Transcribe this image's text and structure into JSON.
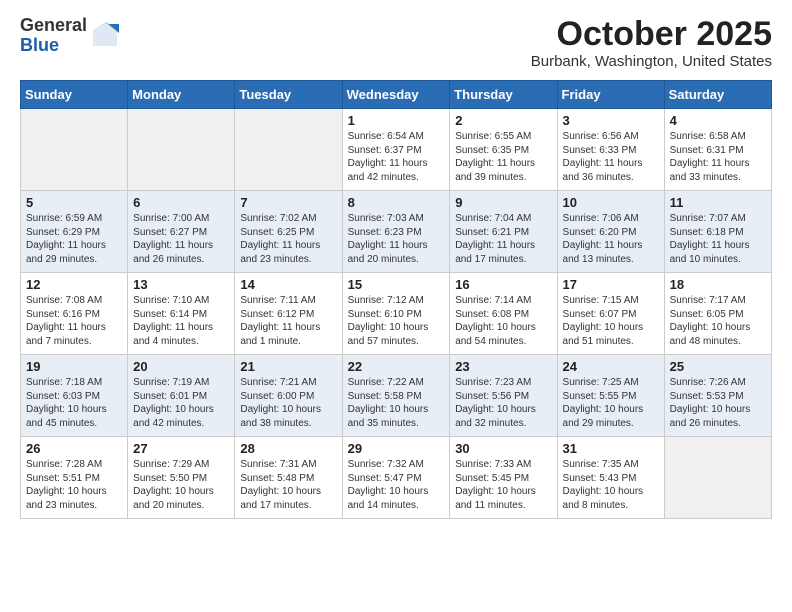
{
  "logo": {
    "general": "General",
    "blue": "Blue"
  },
  "header": {
    "month": "October 2025",
    "location": "Burbank, Washington, United States"
  },
  "weekdays": [
    "Sunday",
    "Monday",
    "Tuesday",
    "Wednesday",
    "Thursday",
    "Friday",
    "Saturday"
  ],
  "weeks": [
    [
      {
        "day": "",
        "empty": true
      },
      {
        "day": "",
        "empty": true
      },
      {
        "day": "",
        "empty": true
      },
      {
        "day": "1",
        "sunrise": "6:54 AM",
        "sunset": "6:37 PM",
        "daylight": "11 hours and 42 minutes."
      },
      {
        "day": "2",
        "sunrise": "6:55 AM",
        "sunset": "6:35 PM",
        "daylight": "11 hours and 39 minutes."
      },
      {
        "day": "3",
        "sunrise": "6:56 AM",
        "sunset": "6:33 PM",
        "daylight": "11 hours and 36 minutes."
      },
      {
        "day": "4",
        "sunrise": "6:58 AM",
        "sunset": "6:31 PM",
        "daylight": "11 hours and 33 minutes."
      }
    ],
    [
      {
        "day": "5",
        "sunrise": "6:59 AM",
        "sunset": "6:29 PM",
        "daylight": "11 hours and 29 minutes."
      },
      {
        "day": "6",
        "sunrise": "7:00 AM",
        "sunset": "6:27 PM",
        "daylight": "11 hours and 26 minutes."
      },
      {
        "day": "7",
        "sunrise": "7:02 AM",
        "sunset": "6:25 PM",
        "daylight": "11 hours and 23 minutes."
      },
      {
        "day": "8",
        "sunrise": "7:03 AM",
        "sunset": "6:23 PM",
        "daylight": "11 hours and 20 minutes."
      },
      {
        "day": "9",
        "sunrise": "7:04 AM",
        "sunset": "6:21 PM",
        "daylight": "11 hours and 17 minutes."
      },
      {
        "day": "10",
        "sunrise": "7:06 AM",
        "sunset": "6:20 PM",
        "daylight": "11 hours and 13 minutes."
      },
      {
        "day": "11",
        "sunrise": "7:07 AM",
        "sunset": "6:18 PM",
        "daylight": "11 hours and 10 minutes."
      }
    ],
    [
      {
        "day": "12",
        "sunrise": "7:08 AM",
        "sunset": "6:16 PM",
        "daylight": "11 hours and 7 minutes."
      },
      {
        "day": "13",
        "sunrise": "7:10 AM",
        "sunset": "6:14 PM",
        "daylight": "11 hours and 4 minutes."
      },
      {
        "day": "14",
        "sunrise": "7:11 AM",
        "sunset": "6:12 PM",
        "daylight": "11 hours and 1 minute."
      },
      {
        "day": "15",
        "sunrise": "7:12 AM",
        "sunset": "6:10 PM",
        "daylight": "10 hours and 57 minutes."
      },
      {
        "day": "16",
        "sunrise": "7:14 AM",
        "sunset": "6:08 PM",
        "daylight": "10 hours and 54 minutes."
      },
      {
        "day": "17",
        "sunrise": "7:15 AM",
        "sunset": "6:07 PM",
        "daylight": "10 hours and 51 minutes."
      },
      {
        "day": "18",
        "sunrise": "7:17 AM",
        "sunset": "6:05 PM",
        "daylight": "10 hours and 48 minutes."
      }
    ],
    [
      {
        "day": "19",
        "sunrise": "7:18 AM",
        "sunset": "6:03 PM",
        "daylight": "10 hours and 45 minutes."
      },
      {
        "day": "20",
        "sunrise": "7:19 AM",
        "sunset": "6:01 PM",
        "daylight": "10 hours and 42 minutes."
      },
      {
        "day": "21",
        "sunrise": "7:21 AM",
        "sunset": "6:00 PM",
        "daylight": "10 hours and 38 minutes."
      },
      {
        "day": "22",
        "sunrise": "7:22 AM",
        "sunset": "5:58 PM",
        "daylight": "10 hours and 35 minutes."
      },
      {
        "day": "23",
        "sunrise": "7:23 AM",
        "sunset": "5:56 PM",
        "daylight": "10 hours and 32 minutes."
      },
      {
        "day": "24",
        "sunrise": "7:25 AM",
        "sunset": "5:55 PM",
        "daylight": "10 hours and 29 minutes."
      },
      {
        "day": "25",
        "sunrise": "7:26 AM",
        "sunset": "5:53 PM",
        "daylight": "10 hours and 26 minutes."
      }
    ],
    [
      {
        "day": "26",
        "sunrise": "7:28 AM",
        "sunset": "5:51 PM",
        "daylight": "10 hours and 23 minutes."
      },
      {
        "day": "27",
        "sunrise": "7:29 AM",
        "sunset": "5:50 PM",
        "daylight": "10 hours and 20 minutes."
      },
      {
        "day": "28",
        "sunrise": "7:31 AM",
        "sunset": "5:48 PM",
        "daylight": "10 hours and 17 minutes."
      },
      {
        "day": "29",
        "sunrise": "7:32 AM",
        "sunset": "5:47 PM",
        "daylight": "10 hours and 14 minutes."
      },
      {
        "day": "30",
        "sunrise": "7:33 AM",
        "sunset": "5:45 PM",
        "daylight": "10 hours and 11 minutes."
      },
      {
        "day": "31",
        "sunrise": "7:35 AM",
        "sunset": "5:43 PM",
        "daylight": "10 hours and 8 minutes."
      },
      {
        "day": "",
        "empty": true
      }
    ]
  ],
  "labels": {
    "sunrise": "Sunrise:",
    "sunset": "Sunset:",
    "daylight": "Daylight:"
  }
}
